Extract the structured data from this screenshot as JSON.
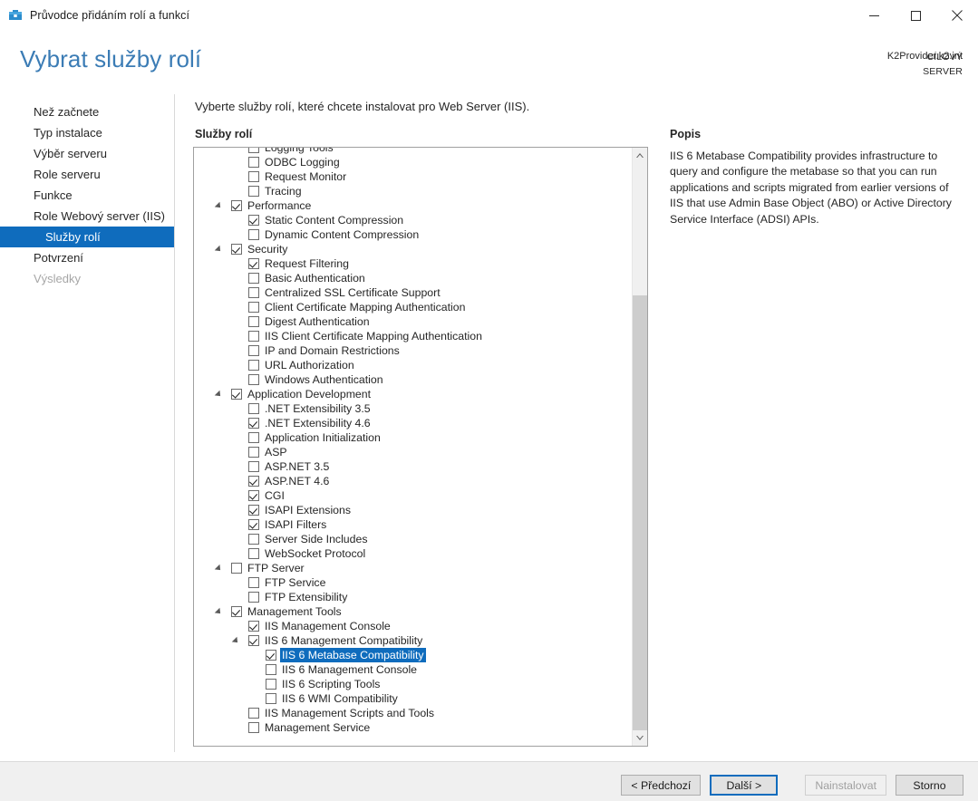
{
  "window": {
    "title": "Průvodce přidáním rolí a funkcí",
    "icon": "server-manager-icon",
    "controls": {
      "minimize": "minimize-icon",
      "maximize": "maximize-icon",
      "close": "close-icon"
    }
  },
  "header": {
    "page_title": "Vybrat služby rolí",
    "target_server_label": "CÍLOVÝ SERVER",
    "target_server_name": "K2Provider.k2.int"
  },
  "sidebar": {
    "items": [
      {
        "label": "Než začnete",
        "state": "normal"
      },
      {
        "label": "Typ instalace",
        "state": "normal"
      },
      {
        "label": "Výběr serveru",
        "state": "normal"
      },
      {
        "label": "Role serveru",
        "state": "normal"
      },
      {
        "label": "Funkce",
        "state": "normal"
      },
      {
        "label": "Role Webový server (IIS)",
        "state": "normal"
      },
      {
        "label": "Služby rolí",
        "state": "selected"
      },
      {
        "label": "Potvrzení",
        "state": "normal"
      },
      {
        "label": "Výsledky",
        "state": "disabled"
      }
    ]
  },
  "main": {
    "instruction": "Vyberte služby rolí, které chcete instalovat pro Web Server (IIS).",
    "list_label": "Služby rolí",
    "description_label": "Popis",
    "description_body": "IIS 6 Metabase Compatibility provides infrastructure to query and configure the metabase so that you can run applications and scripts migrated from earlier versions of IIS that use Admin Base Object (ABO) or Active Directory Service Interface (ADSI) APIs.",
    "tree": [
      {
        "label": "Logging Tools",
        "level": 2,
        "checked": false,
        "expander": false,
        "selected": false
      },
      {
        "label": "ODBC Logging",
        "level": 2,
        "checked": false,
        "expander": false,
        "selected": false
      },
      {
        "label": "Request Monitor",
        "level": 2,
        "checked": false,
        "expander": false,
        "selected": false
      },
      {
        "label": "Tracing",
        "level": 2,
        "checked": false,
        "expander": false,
        "selected": false
      },
      {
        "label": "Performance",
        "level": 1,
        "checked": true,
        "expander": true,
        "selected": false
      },
      {
        "label": "Static Content Compression",
        "level": 2,
        "checked": true,
        "expander": false,
        "selected": false
      },
      {
        "label": "Dynamic Content Compression",
        "level": 2,
        "checked": false,
        "expander": false,
        "selected": false
      },
      {
        "label": "Security",
        "level": 1,
        "checked": true,
        "expander": true,
        "selected": false
      },
      {
        "label": "Request Filtering",
        "level": 2,
        "checked": true,
        "expander": false,
        "selected": false
      },
      {
        "label": "Basic Authentication",
        "level": 2,
        "checked": false,
        "expander": false,
        "selected": false
      },
      {
        "label": "Centralized SSL Certificate Support",
        "level": 2,
        "checked": false,
        "expander": false,
        "selected": false
      },
      {
        "label": "Client Certificate Mapping Authentication",
        "level": 2,
        "checked": false,
        "expander": false,
        "selected": false
      },
      {
        "label": "Digest Authentication",
        "level": 2,
        "checked": false,
        "expander": false,
        "selected": false
      },
      {
        "label": "IIS Client Certificate Mapping Authentication",
        "level": 2,
        "checked": false,
        "expander": false,
        "selected": false
      },
      {
        "label": "IP and Domain Restrictions",
        "level": 2,
        "checked": false,
        "expander": false,
        "selected": false
      },
      {
        "label": "URL Authorization",
        "level": 2,
        "checked": false,
        "expander": false,
        "selected": false
      },
      {
        "label": "Windows Authentication",
        "level": 2,
        "checked": false,
        "expander": false,
        "selected": false
      },
      {
        "label": "Application Development",
        "level": 1,
        "checked": true,
        "expander": true,
        "selected": false
      },
      {
        "label": ".NET Extensibility 3.5",
        "level": 2,
        "checked": false,
        "expander": false,
        "selected": false
      },
      {
        "label": ".NET Extensibility 4.6",
        "level": 2,
        "checked": true,
        "expander": false,
        "selected": false
      },
      {
        "label": "Application Initialization",
        "level": 2,
        "checked": false,
        "expander": false,
        "selected": false
      },
      {
        "label": "ASP",
        "level": 2,
        "checked": false,
        "expander": false,
        "selected": false
      },
      {
        "label": "ASP.NET 3.5",
        "level": 2,
        "checked": false,
        "expander": false,
        "selected": false
      },
      {
        "label": "ASP.NET 4.6",
        "level": 2,
        "checked": true,
        "expander": false,
        "selected": false
      },
      {
        "label": "CGI",
        "level": 2,
        "checked": true,
        "expander": false,
        "selected": false
      },
      {
        "label": "ISAPI Extensions",
        "level": 2,
        "checked": true,
        "expander": false,
        "selected": false
      },
      {
        "label": "ISAPI Filters",
        "level": 2,
        "checked": true,
        "expander": false,
        "selected": false
      },
      {
        "label": "Server Side Includes",
        "level": 2,
        "checked": false,
        "expander": false,
        "selected": false
      },
      {
        "label": "WebSocket Protocol",
        "level": 2,
        "checked": false,
        "expander": false,
        "selected": false
      },
      {
        "label": "FTP Server",
        "level": 1,
        "checked": false,
        "expander": true,
        "selected": false
      },
      {
        "label": "FTP Service",
        "level": 2,
        "checked": false,
        "expander": false,
        "selected": false
      },
      {
        "label": "FTP Extensibility",
        "level": 2,
        "checked": false,
        "expander": false,
        "selected": false
      },
      {
        "label": "Management Tools",
        "level": 1,
        "checked": true,
        "expander": true,
        "selected": false
      },
      {
        "label": "IIS Management Console",
        "level": 2,
        "checked": true,
        "expander": false,
        "selected": false
      },
      {
        "label": "IIS 6 Management Compatibility",
        "level": 2,
        "checked": true,
        "expander": true,
        "selected": false
      },
      {
        "label": "IIS 6 Metabase Compatibility",
        "level": 3,
        "checked": true,
        "expander": false,
        "selected": true
      },
      {
        "label": "IIS 6 Management Console",
        "level": 3,
        "checked": false,
        "expander": false,
        "selected": false
      },
      {
        "label": "IIS 6 Scripting Tools",
        "level": 3,
        "checked": false,
        "expander": false,
        "selected": false
      },
      {
        "label": "IIS 6 WMI Compatibility",
        "level": 3,
        "checked": false,
        "expander": false,
        "selected": false
      },
      {
        "label": "IIS Management Scripts and Tools",
        "level": 2,
        "checked": false,
        "expander": false,
        "selected": false
      },
      {
        "label": "Management Service",
        "level": 2,
        "checked": false,
        "expander": false,
        "selected": false
      }
    ]
  },
  "footer": {
    "previous_label": "< Předchozí",
    "next_label": "Další >",
    "install_label": "Nainstalovat",
    "cancel_label": "Storno"
  },
  "colors": {
    "accent": "#0f6cbd",
    "title_blue": "#3b7cb5",
    "footer_bg": "#f0f0f0"
  }
}
